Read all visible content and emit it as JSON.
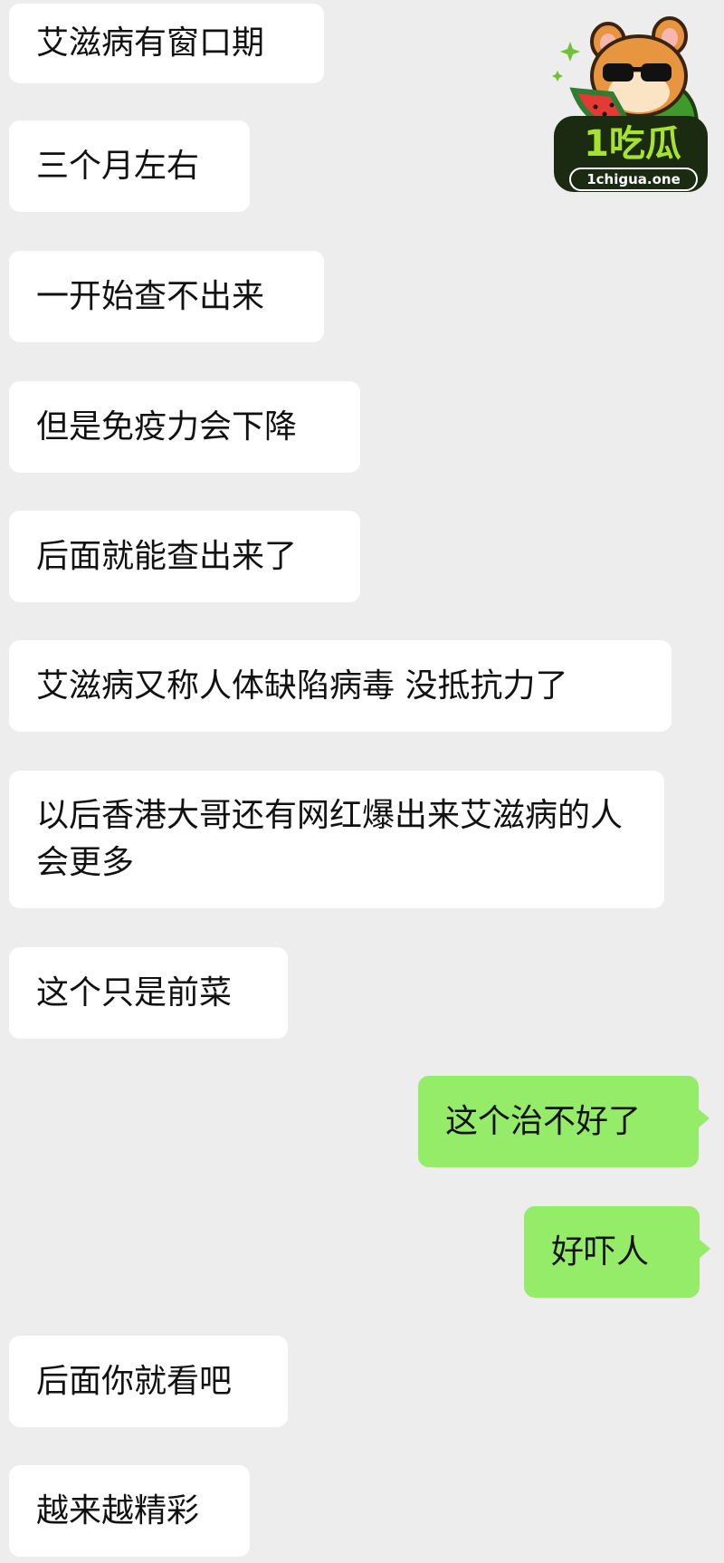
{
  "messages": [
    {
      "side": "in",
      "text": "艾滋病有窗口期"
    },
    {
      "side": "in",
      "text": "三个月左右"
    },
    {
      "side": "in",
      "text": "一开始查不出来"
    },
    {
      "side": "in",
      "text": "但是免疫力会下降"
    },
    {
      "side": "in",
      "text": "后面就能查出来了"
    },
    {
      "side": "in",
      "text": "艾滋病又称人体缺陷病毒 没抵抗力了"
    },
    {
      "side": "in",
      "text": "以后香港大哥还有网红爆出来艾滋病的人会更多"
    },
    {
      "side": "in",
      "text": "这个只是前菜"
    },
    {
      "side": "out",
      "text": "这个治不好了"
    },
    {
      "side": "out",
      "text": "好吓人"
    },
    {
      "side": "in",
      "text": "后面你就看吧"
    },
    {
      "side": "in",
      "text": "越来越精彩"
    }
  ],
  "watermark": {
    "brand": "1吃瓜",
    "url": "1chigua.one"
  },
  "colors": {
    "background": "#ededed",
    "incoming_bubble": "#ffffff",
    "outgoing_bubble": "#95ec69"
  }
}
